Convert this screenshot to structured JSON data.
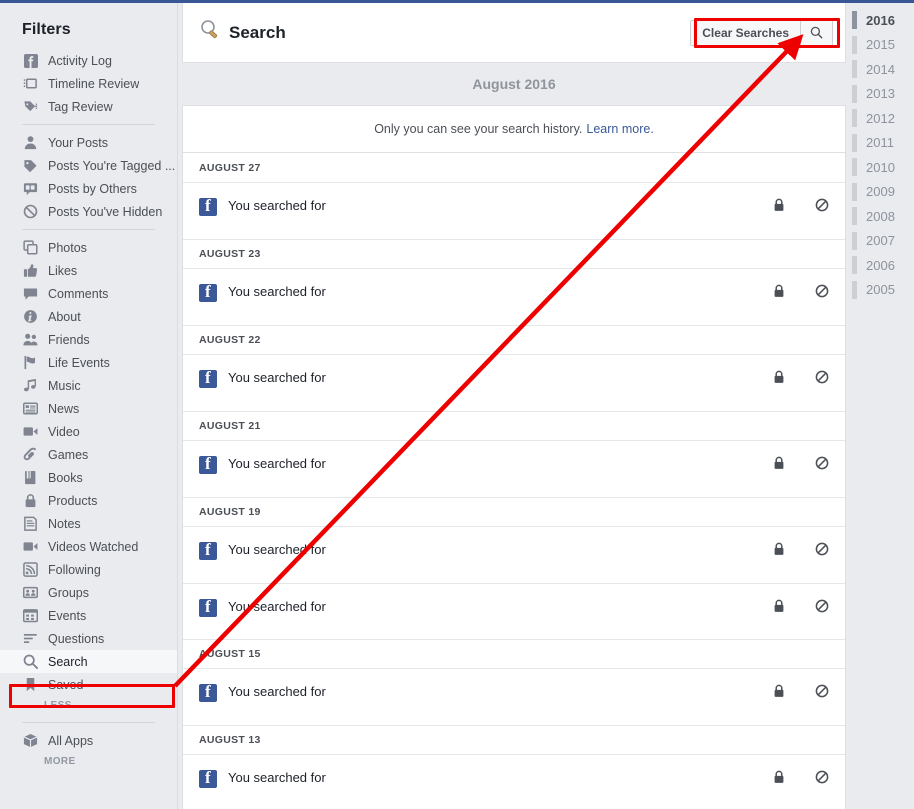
{
  "theme": {
    "brand_blue": "#3b5998",
    "page_bg": "#e9ebee",
    "card_bg": "#ffffff",
    "text_primary": "#1d2129",
    "text_secondary": "#4b4f56",
    "text_muted": "#90949c",
    "link_blue": "#3b5998",
    "highlight_red": "#ee0000",
    "border": "#dddfe2"
  },
  "sidebar": {
    "title": "Filters",
    "groups": [
      {
        "items": [
          {
            "label": "Activity Log",
            "icon": "facebook-icon",
            "active": false
          },
          {
            "label": "Timeline Review",
            "icon": "timeline-review-icon",
            "active": false
          },
          {
            "label": "Tag Review",
            "icon": "tag-review-icon",
            "active": false
          }
        ]
      },
      {
        "items": [
          {
            "label": "Your Posts",
            "icon": "person-icon",
            "active": false
          },
          {
            "label": "Posts You're Tagged ...",
            "icon": "tag-icon",
            "active": false
          },
          {
            "label": "Posts by Others",
            "icon": "posts-by-others-icon",
            "active": false
          },
          {
            "label": "Posts You've Hidden",
            "icon": "hidden-icon",
            "active": false
          }
        ]
      },
      {
        "items": [
          {
            "label": "Photos",
            "icon": "photos-icon",
            "active": false
          },
          {
            "label": "Likes",
            "icon": "thumbs-up-icon",
            "active": false
          },
          {
            "label": "Comments",
            "icon": "comment-icon",
            "active": false
          },
          {
            "label": "About",
            "icon": "info-icon",
            "active": false
          },
          {
            "label": "Friends",
            "icon": "friends-icon",
            "active": false
          },
          {
            "label": "Life Events",
            "icon": "flag-icon",
            "active": false
          },
          {
            "label": "Music",
            "icon": "music-note-icon",
            "active": false
          },
          {
            "label": "News",
            "icon": "news-icon",
            "active": false
          },
          {
            "label": "Video",
            "icon": "video-camera-icon",
            "active": false
          },
          {
            "label": "Games",
            "icon": "games-icon",
            "active": false
          },
          {
            "label": "Books",
            "icon": "book-icon",
            "active": false
          },
          {
            "label": "Products",
            "icon": "products-icon",
            "active": false
          },
          {
            "label": "Notes",
            "icon": "notes-icon",
            "active": false
          },
          {
            "label": "Videos Watched",
            "icon": "video-camera-icon",
            "active": false
          },
          {
            "label": "Following",
            "icon": "rss-icon",
            "active": false
          },
          {
            "label": "Groups",
            "icon": "groups-icon",
            "active": false
          },
          {
            "label": "Events",
            "icon": "calendar-icon",
            "active": false
          },
          {
            "label": "Questions",
            "icon": "questions-icon",
            "active": false
          },
          {
            "label": "Search",
            "icon": "search-icon",
            "active": true
          },
          {
            "label": "Saved",
            "icon": "bookmark-icon",
            "active": false
          }
        ],
        "toggle": "LESS"
      },
      {
        "items": [
          {
            "label": "All Apps",
            "icon": "apps-box-icon",
            "active": false
          }
        ],
        "toggle": "MORE"
      }
    ]
  },
  "header": {
    "title": "Search",
    "title_icon": "magnifier-icon",
    "clear_label": "Clear Searches",
    "search_icon": "search-icon"
  },
  "month_header": "August 2016",
  "notice": {
    "text": "Only you can see your search history.",
    "link": "Learn more."
  },
  "entry_actions": {
    "privacy_icon": "lock-icon",
    "privacy_label": "Only Me",
    "remove_icon": "circle-slash-icon",
    "remove_label": "Remove"
  },
  "log": {
    "days": [
      {
        "date": "AUGUST 27",
        "entries": [
          {
            "text": "You searched for"
          }
        ]
      },
      {
        "date": "AUGUST 23",
        "entries": [
          {
            "text": "You searched for"
          }
        ]
      },
      {
        "date": "AUGUST 22",
        "entries": [
          {
            "text": "You searched for"
          }
        ]
      },
      {
        "date": "AUGUST 21",
        "entries": [
          {
            "text": "You searched for"
          }
        ]
      },
      {
        "date": "AUGUST 19",
        "entries": [
          {
            "text": "You searched for"
          },
          {
            "text": "You searched for"
          }
        ]
      },
      {
        "date": "AUGUST 15",
        "entries": [
          {
            "text": "You searched for"
          }
        ]
      },
      {
        "date": "AUGUST 13",
        "entries": [
          {
            "text": "You searched for"
          }
        ]
      }
    ]
  },
  "years": {
    "selected": "2016",
    "items": [
      "2016",
      "2015",
      "2014",
      "2013",
      "2012",
      "2011",
      "2010",
      "2009",
      "2008",
      "2007",
      "2006",
      "2005"
    ]
  },
  "annotations": {
    "arrow_color": "#ee0000",
    "boxes": [
      "clear-searches-button",
      "sidebar-item-search"
    ]
  }
}
